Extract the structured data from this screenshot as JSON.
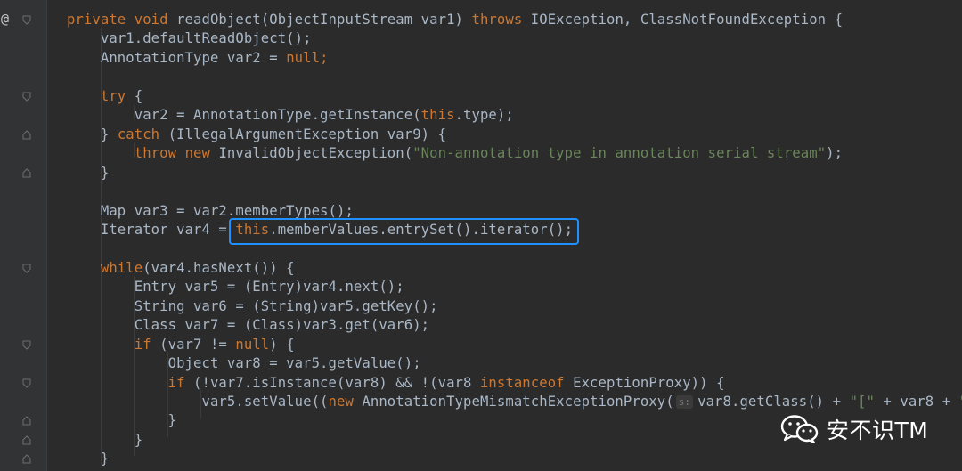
{
  "gutter": {
    "override_marker": "@"
  },
  "code": {
    "lines": [
      [
        {
          "t": "private ",
          "c": "kw"
        },
        {
          "t": "void ",
          "c": "kw"
        },
        {
          "t": "readObject(ObjectInputStream var1) "
        },
        {
          "t": "throws ",
          "c": "kw"
        },
        {
          "t": "IOException, ClassNotFoundException {"
        }
      ],
      [
        {
          "t": "    var1.defaultReadObject();"
        }
      ],
      [
        {
          "t": "    AnnotationType var2 = "
        },
        {
          "t": "null",
          "c": "kw"
        },
        {
          "t": ";",
          "c": "kw"
        }
      ],
      [],
      [
        {
          "t": "    "
        },
        {
          "t": "try ",
          "c": "kw"
        },
        {
          "t": "{"
        }
      ],
      [
        {
          "t": "        var2 = AnnotationType.getInstance("
        },
        {
          "t": "this",
          "c": "kw"
        },
        {
          "t": ".type);"
        }
      ],
      [
        {
          "t": "    } "
        },
        {
          "t": "catch ",
          "c": "kw"
        },
        {
          "t": "(IllegalArgumentException var9) {"
        }
      ],
      [
        {
          "t": "        "
        },
        {
          "t": "throw ",
          "c": "kw"
        },
        {
          "t": "new ",
          "c": "kw"
        },
        {
          "t": "InvalidObjectException("
        },
        {
          "t": "\"Non-annotation type in annotation serial stream\"",
          "c": "str"
        },
        {
          "t": ");"
        }
      ],
      [
        {
          "t": "    }"
        }
      ],
      [],
      [
        {
          "t": "    Map var3 = var2.memberTypes();"
        }
      ],
      [
        {
          "t": "    Iterator var4 = "
        },
        {
          "t": "this",
          "c": "kw"
        },
        {
          "t": ".memberValues.entrySet().iterator();"
        }
      ],
      [],
      [
        {
          "t": "    "
        },
        {
          "t": "while",
          "c": "kw"
        },
        {
          "t": "(var4.hasNext()) {"
        }
      ],
      [
        {
          "t": "        Entry var5 = (Entry)var4.next();"
        }
      ],
      [
        {
          "t": "        String var6 = (String)var5.getKey();"
        }
      ],
      [
        {
          "t": "        Class var7 = (Class)var3.get(var6);"
        }
      ],
      [
        {
          "t": "        "
        },
        {
          "t": "if ",
          "c": "kw"
        },
        {
          "t": "(var7 != "
        },
        {
          "t": "null",
          "c": "kw"
        },
        {
          "t": ") {"
        }
      ],
      [
        {
          "t": "            Object var8 = var5.getValue();"
        }
      ],
      [
        {
          "t": "            "
        },
        {
          "t": "if ",
          "c": "kw"
        },
        {
          "t": "(!var7.isInstance(var8) && !(var8 "
        },
        {
          "t": "instanceof ",
          "c": "kw"
        },
        {
          "t": "ExceptionProxy)) {"
        }
      ],
      [
        {
          "t": "                var5.setValue(("
        },
        {
          "t": "new ",
          "c": "kw"
        },
        {
          "t": "AnnotationTypeMismatchExceptionProxy("
        },
        {
          "t": "s:",
          "c": "hint"
        },
        {
          "t": "var8.getClass() + "
        },
        {
          "t": "\"[\"",
          "c": "str"
        },
        {
          "t": " + var8 + "
        },
        {
          "t": "\"]",
          "c": "str"
        }
      ],
      [
        {
          "t": "            }"
        }
      ],
      [
        {
          "t": "        }"
        }
      ],
      [
        {
          "t": "    }"
        }
      ]
    ]
  },
  "watermark": {
    "text": "安不识TM",
    "icon": "wechat-icon"
  },
  "colors": {
    "background": "#2b2b2b",
    "keyword": "#cc7832",
    "string": "#6a8759",
    "text": "#a9b7c6",
    "highlight_box": "#1e90ff"
  }
}
